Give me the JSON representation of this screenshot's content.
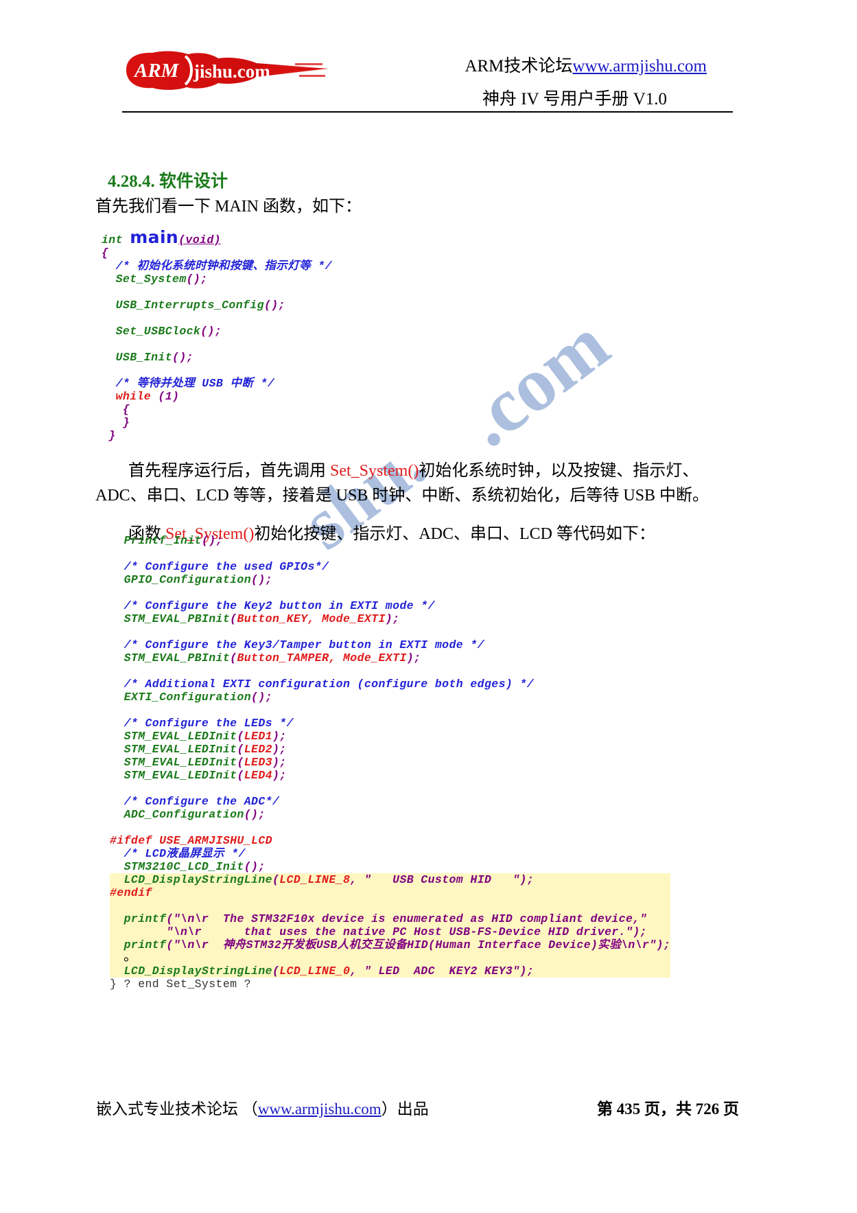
{
  "header": {
    "logo_text_left": "ARM",
    "logo_text_right": "jishu.com",
    "line1_prefix": "ARM技术论坛",
    "line1_url": "www.armjishu.com",
    "line2": "神舟 IV 号用户手册 V1.0"
  },
  "watermark": {
    "part1": "shu.",
    "part2": ".com"
  },
  "section": {
    "heading": "4.28.4. 软件设计",
    "intro": "首先我们看一下 MAIN 函数，如下："
  },
  "code_main": {
    "lines": [
      [
        {
          "t": "int ",
          "c": "kw"
        },
        {
          "t": "main",
          "c": "mainbig"
        },
        {
          "t": "(void)",
          "c": "voidtok"
        }
      ],
      [
        {
          "t": "{",
          "c": "punc"
        }
      ],
      [
        {
          "t": "  /* 初始化系统时钟和按键、指示灯等 */",
          "c": "cmt"
        }
      ],
      [
        {
          "t": "  Set_System",
          "c": "fn"
        },
        {
          "t": "();",
          "c": "punc"
        }
      ],
      [
        {
          "t": "",
          "c": "plain"
        }
      ],
      [
        {
          "t": "  USB_Interrupts_Config",
          "c": "fn"
        },
        {
          "t": "();",
          "c": "punc"
        }
      ],
      [
        {
          "t": "",
          "c": "plain"
        }
      ],
      [
        {
          "t": "  Set_USBClock",
          "c": "fn"
        },
        {
          "t": "();",
          "c": "punc"
        }
      ],
      [
        {
          "t": "",
          "c": "plain"
        }
      ],
      [
        {
          "t": "  USB_Init",
          "c": "fn"
        },
        {
          "t": "();",
          "c": "punc"
        }
      ],
      [
        {
          "t": "",
          "c": "plain"
        }
      ],
      [
        {
          "t": "  /* 等待并处理 USB 中断 */",
          "c": "cmt"
        }
      ],
      [
        {
          "t": "  while",
          "c": "red"
        },
        {
          "t": " (1)",
          "c": "punc"
        }
      ],
      [
        {
          "t": "   {",
          "c": "punc"
        }
      ],
      [
        {
          "t": "   }",
          "c": "punc"
        }
      ],
      [
        {
          "t": " }",
          "c": "punc"
        }
      ]
    ]
  },
  "body": {
    "para1_a": "首先程序运行后，首先调用 ",
    "para1_red": "Set_System()",
    "para1_b": "初始化系统时钟，以及按键、指示灯、ADC、串口、LCD 等等，接着是 USB 时钟、中断、系统初始化，后等待 USB 中断。",
    "para2_a": "函数 ",
    "para2_red": "Set_System()",
    "para2_b": "初始化按键、指示灯、ADC、串口、LCD 等代码如下："
  },
  "code_sys": {
    "lines": [
      [
        {
          "t": "  Printf_Init",
          "c": "fn"
        },
        {
          "t": "();",
          "c": "punc"
        }
      ],
      [
        {
          "t": "",
          "c": "plain"
        }
      ],
      [
        {
          "t": "  /* Configure the used GPIOs*/",
          "c": "cmt"
        }
      ],
      [
        {
          "t": "  GPIO_Configuration",
          "c": "fn"
        },
        {
          "t": "();",
          "c": "punc"
        }
      ],
      [
        {
          "t": "",
          "c": "plain"
        }
      ],
      [
        {
          "t": "  /* Configure the Key2 button in EXTI mode */",
          "c": "cmt"
        }
      ],
      [
        {
          "t": "  STM_EVAL_PBInit",
          "c": "fn"
        },
        {
          "t": "(",
          "c": "punc"
        },
        {
          "t": "Button_KEY, Mode_EXTI",
          "c": "red"
        },
        {
          "t": ");",
          "c": "punc"
        }
      ],
      [
        {
          "t": "",
          "c": "plain"
        }
      ],
      [
        {
          "t": "  /* Configure the Key3/Tamper button in EXTI mode */",
          "c": "cmt"
        }
      ],
      [
        {
          "t": "  STM_EVAL_PBInit",
          "c": "fn"
        },
        {
          "t": "(",
          "c": "punc"
        },
        {
          "t": "Button_TAMPER, Mode_EXTI",
          "c": "red"
        },
        {
          "t": ");",
          "c": "punc"
        }
      ],
      [
        {
          "t": "",
          "c": "plain"
        }
      ],
      [
        {
          "t": "  /* Additional EXTI configuration (configure both edges) */",
          "c": "cmt"
        }
      ],
      [
        {
          "t": "  EXTI_Configuration",
          "c": "fn"
        },
        {
          "t": "();",
          "c": "punc"
        }
      ],
      [
        {
          "t": "",
          "c": "plain"
        }
      ],
      [
        {
          "t": "  /* Configure the LEDs */",
          "c": "cmt"
        }
      ],
      [
        {
          "t": "  STM_EVAL_LEDInit",
          "c": "fn"
        },
        {
          "t": "(",
          "c": "punc"
        },
        {
          "t": "LED1",
          "c": "red"
        },
        {
          "t": ");",
          "c": "punc"
        }
      ],
      [
        {
          "t": "  STM_EVAL_LEDInit",
          "c": "fn"
        },
        {
          "t": "(",
          "c": "punc"
        },
        {
          "t": "LED2",
          "c": "red"
        },
        {
          "t": ");",
          "c": "punc"
        }
      ],
      [
        {
          "t": "  STM_EVAL_LEDInit",
          "c": "fn"
        },
        {
          "t": "(",
          "c": "punc"
        },
        {
          "t": "LED3",
          "c": "red"
        },
        {
          "t": ");",
          "c": "punc"
        }
      ],
      [
        {
          "t": "  STM_EVAL_LEDInit",
          "c": "fn"
        },
        {
          "t": "(",
          "c": "punc"
        },
        {
          "t": "LED4",
          "c": "red"
        },
        {
          "t": ");",
          "c": "punc"
        }
      ],
      [
        {
          "t": "",
          "c": "plain"
        }
      ],
      [
        {
          "t": "  /* Configure the ADC*/",
          "c": "cmt"
        }
      ],
      [
        {
          "t": "  ADC_Configuration",
          "c": "fn"
        },
        {
          "t": "();",
          "c": "punc"
        }
      ],
      [
        {
          "t": "",
          "c": "plain"
        }
      ],
      [
        {
          "t": "#ifdef USE_ARMJISHU_LCD",
          "c": "pre"
        }
      ],
      [
        {
          "t": "  /* LCD液晶屏显示 */",
          "c": "cmt"
        }
      ],
      [
        {
          "t": "  STM3210C_LCD_Init",
          "c": "fn"
        },
        {
          "t": "();",
          "c": "punc"
        }
      ]
    ],
    "highlight_lines": [
      [
        {
          "t": "  LCD_DisplayStringLine",
          "c": "fn"
        },
        {
          "t": "(",
          "c": "punc"
        },
        {
          "t": "LCD_LINE_8",
          "c": "red"
        },
        {
          "t": ", \"   USB Custom HID   \");",
          "c": "punc"
        }
      ],
      [
        {
          "t": "#endif",
          "c": "pre"
        }
      ],
      [
        {
          "t": "",
          "c": "plain"
        }
      ],
      [
        {
          "t": "  printf",
          "c": "fn"
        },
        {
          "t": "(\"\\n\\r  The STM32F10x device is enumerated as HID compliant device,\"",
          "c": "punc"
        }
      ],
      [
        {
          "t": "        \"\\n\\r      that uses the native PC Host USB-FS-Device HID driver.\");",
          "c": "punc"
        }
      ],
      [
        {
          "t": "  printf",
          "c": "fn"
        },
        {
          "t": "(\"\\n\\r  ",
          "c": "punc"
        },
        {
          "t": "神舟STM32开发板USB人机交互设备HID(Human Interface Device)实验",
          "c": "punc"
        },
        {
          "t": "\\n\\r\");",
          "c": "punc"
        }
      ],
      [
        {
          "t": "",
          "c": "plain"
        }
      ],
      [
        {
          "t": "  LCD_DisplayStringLine",
          "c": "fn"
        },
        {
          "t": "(",
          "c": "punc"
        },
        {
          "t": "LCD_LINE_0",
          "c": "red"
        },
        {
          "t": ", \" LED  ADC  KEY2 KEY3\");",
          "c": "punc"
        }
      ]
    ],
    "end_line": "} ? end Set_System ?",
    "trailing_mark": "。"
  },
  "footer": {
    "left_prefix": "嵌入式专业技术论坛 （",
    "left_url": "www.armjishu.com",
    "left_suffix": "）出品",
    "right": "第 435 页，共 726 页"
  }
}
